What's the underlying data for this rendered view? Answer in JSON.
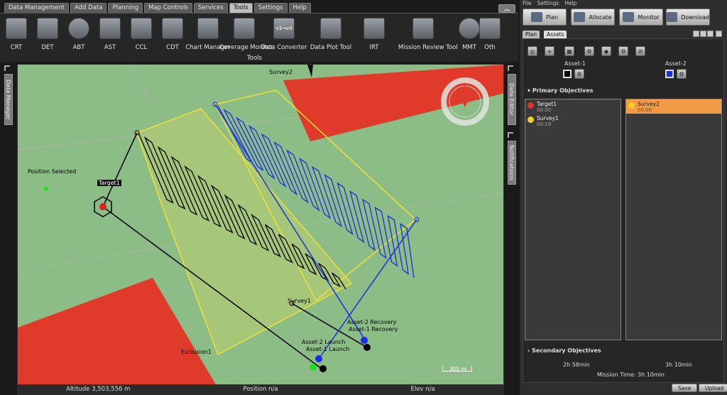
{
  "menu_tabs": [
    "Data Management",
    "Add Data",
    "Planning",
    "Map Controls",
    "Services",
    "Tools",
    "Settings",
    "Help"
  ],
  "active_menu": "Tools",
  "tools": [
    {
      "label": "CRT",
      "icon": "magnifier-icon"
    },
    {
      "label": "DET",
      "icon": "arrows-icon"
    },
    {
      "label": "ABT",
      "icon": "globe-grid-icon"
    },
    {
      "label": "AST",
      "icon": "matrix-icon"
    },
    {
      "label": "CCL",
      "icon": "star-burst-icon"
    },
    {
      "label": "CDT",
      "icon": "dots-icon"
    },
    {
      "label": "Chart Manager",
      "icon": "chart-map-icon"
    },
    {
      "label": "Coverage Monitor",
      "icon": "coverage-icon"
    },
    {
      "label": "Data Converter",
      "icon": "v3-v4-icon",
      "glyph": "v3→v4"
    },
    {
      "label": "Data Plot Tool",
      "icon": "plot-icon"
    },
    {
      "label": "IRT",
      "icon": "irt-icon"
    },
    {
      "label": "Mission Review Tool",
      "icon": "document-icon"
    },
    {
      "label": "MMT",
      "icon": "compass-globe-icon"
    },
    {
      "label": "Oth",
      "icon": "arrow-down-icon"
    }
  ],
  "tools_group_label": "Tools",
  "side_tabs": {
    "left": "Data Manager",
    "right_top": "Data Editor",
    "right_bottom": "Notifications"
  },
  "map": {
    "labels": {
      "survey2": "Survey2",
      "position_selected": "Position Selected",
      "target1": "Target1",
      "survey1": "Survey1",
      "exclusion1": "Exclusion1",
      "asset2_recovery": "Asset-2 Recovery",
      "asset1_recovery": "Asset-1 Recovery",
      "asset2_launch": "Asset-2 Launch",
      "asset1_launch": "Asset-1 Launch",
      "scale": "300 m"
    },
    "colors": {
      "land": "#8dbd86",
      "exclusion": "#e03a2a",
      "survey1_fill": "#a8c878",
      "survey1_edge": "#f0e030",
      "asset1_path": "#000000",
      "asset2_path": "#1a2ee0"
    }
  },
  "status": {
    "altitude": "Altitude 3,503,556 m",
    "position": "Position n/a",
    "elev": "Elev n/a"
  },
  "right_panel": {
    "menu": [
      "File",
      "Settings",
      "Help"
    ],
    "buttons": [
      "Plan",
      "Allocate",
      "Monitor",
      "Download"
    ],
    "tabs": [
      "Plan",
      "Assets"
    ],
    "assets": [
      {
        "name": "Asset-1",
        "color": "#000000"
      },
      {
        "name": "Asset-2",
        "color": "#1a2ee0"
      }
    ],
    "primary_title": "Primary Objectives",
    "asset1_objectives": [
      {
        "name": "Target1",
        "time": "00:00",
        "color": "#e03030"
      },
      {
        "name": "Survey1",
        "time": "00:19",
        "color": "#f0d020"
      }
    ],
    "asset2_objectives": [
      {
        "name": "Survey2",
        "time": "00:00",
        "color": "#f0d020"
      }
    ],
    "secondary_title": "Secondary Objectives",
    "asset1_time": "2h 58min",
    "asset2_time": "3h 10min",
    "mission_time": "Mission Time: 3h 10min",
    "save": "Save",
    "upload": "Upload"
  }
}
